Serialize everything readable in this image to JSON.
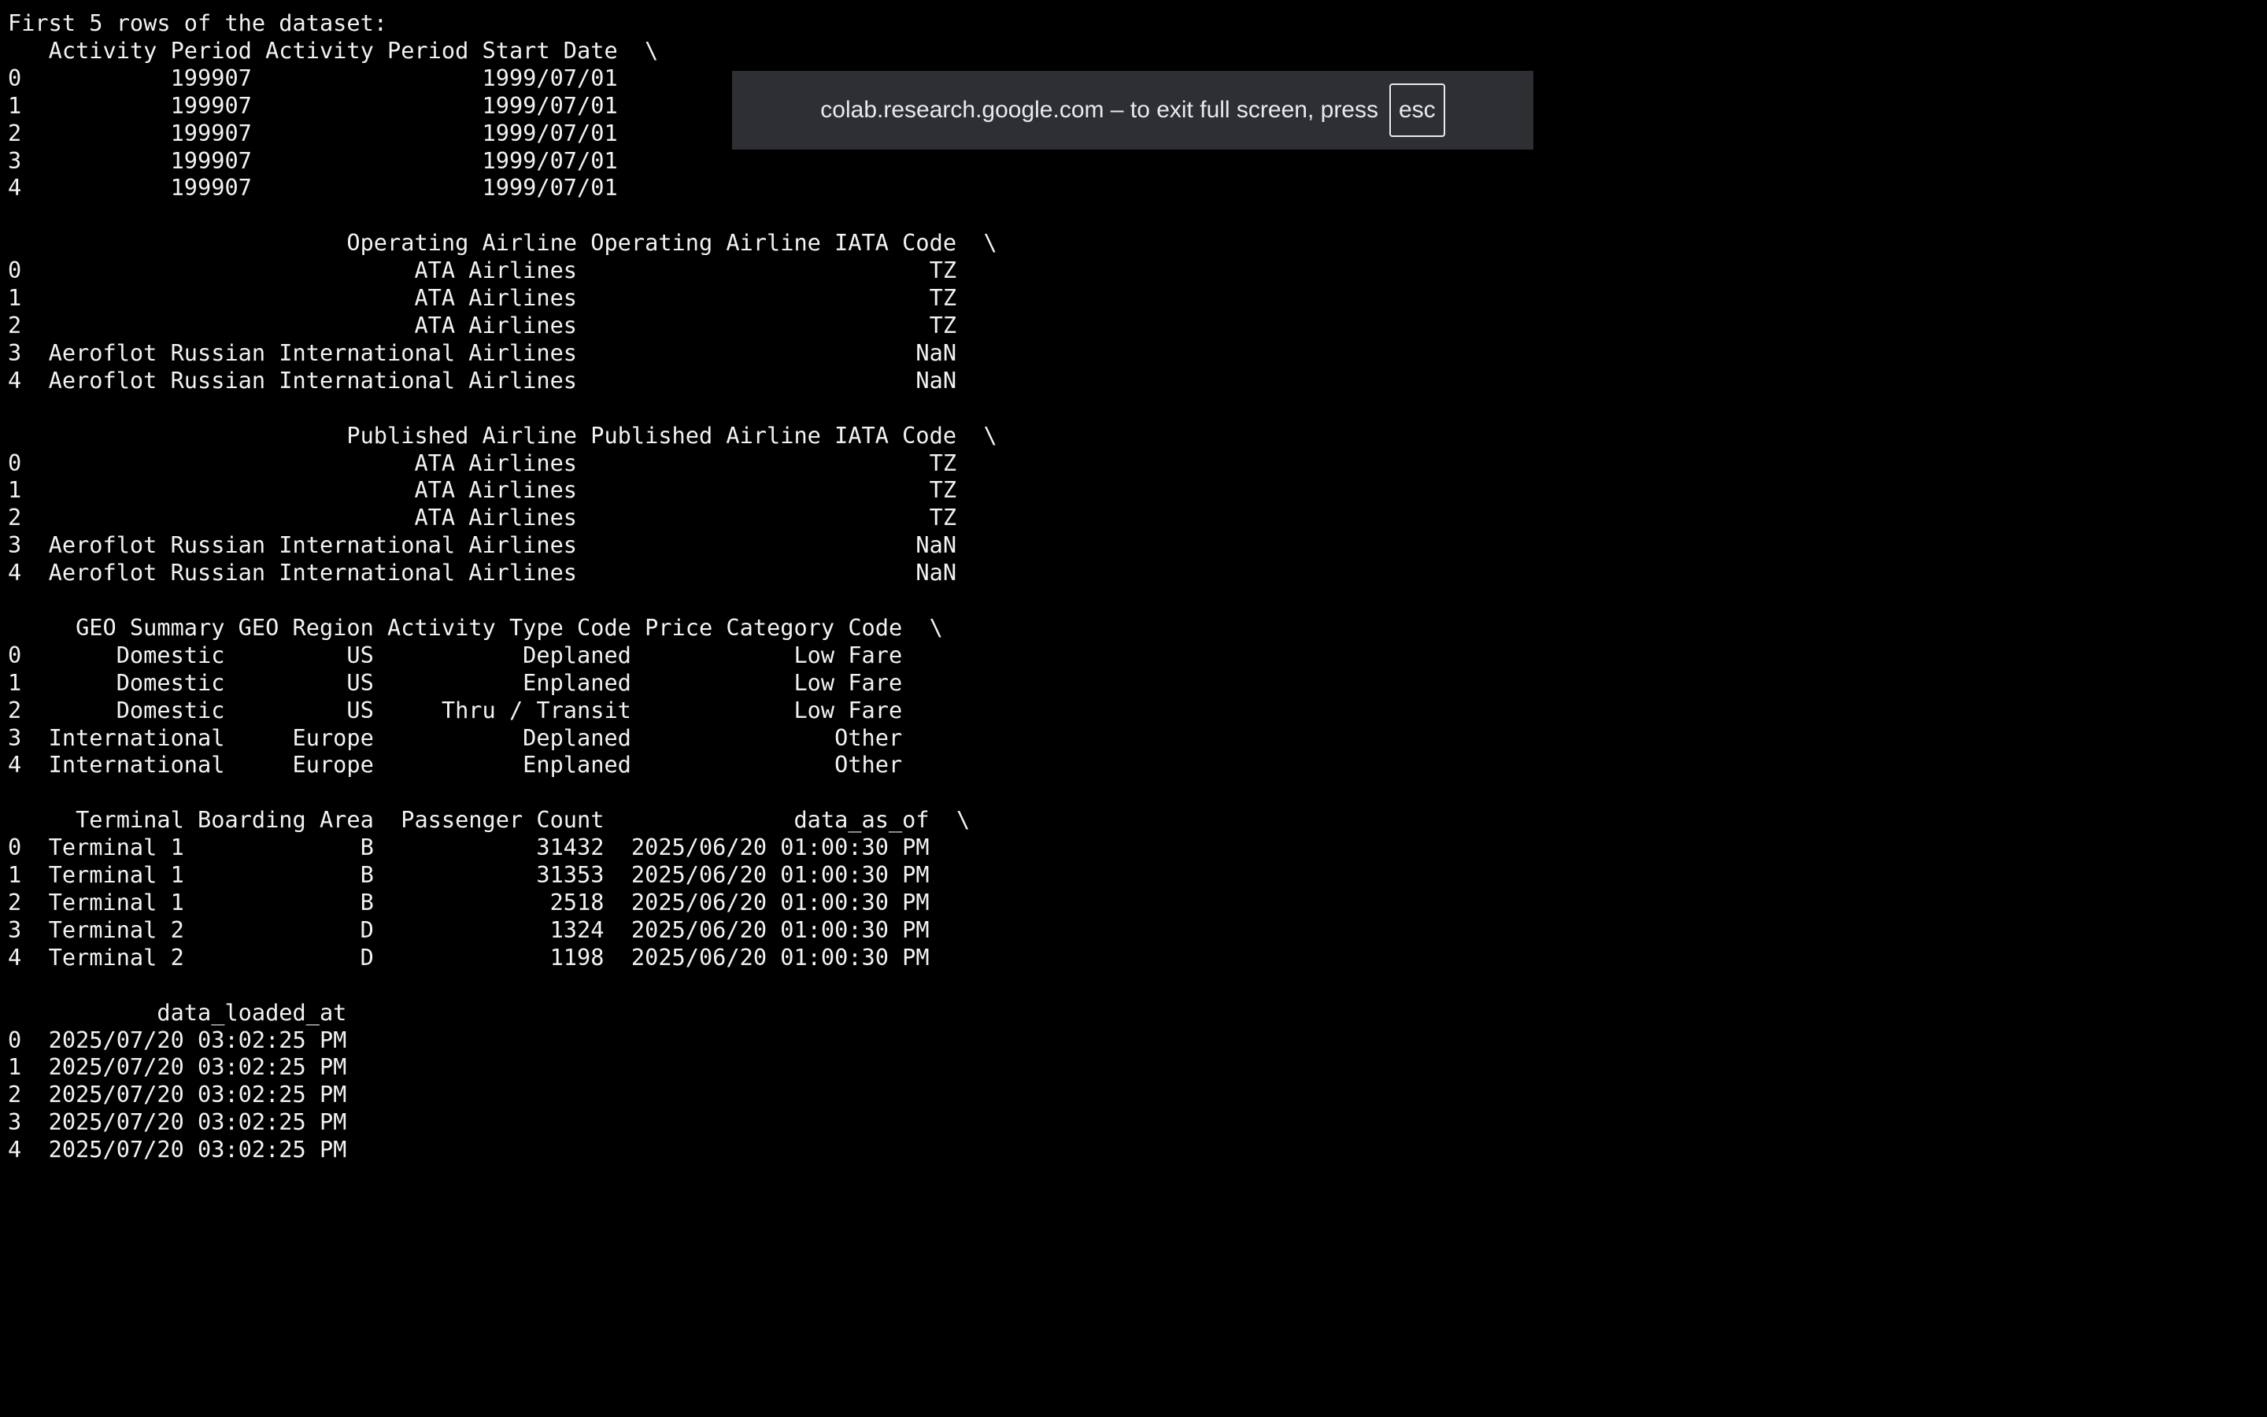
{
  "output": {
    "lines": [
      "First 5 rows of the dataset:",
      "   Activity Period Activity Period Start Date  \\",
      "0           199907                 1999/07/01   ",
      "1           199907                 1999/07/01   ",
      "2           199907                 1999/07/01   ",
      "3           199907                 1999/07/01   ",
      "4           199907                 1999/07/01   ",
      "",
      "                         Operating Airline Operating Airline IATA Code  \\",
      "0                             ATA Airlines                          TZ   ",
      "1                             ATA Airlines                          TZ   ",
      "2                             ATA Airlines                          TZ   ",
      "3  Aeroflot Russian International Airlines                         NaN   ",
      "4  Aeroflot Russian International Airlines                         NaN   ",
      "",
      "                         Published Airline Published Airline IATA Code  \\",
      "0                             ATA Airlines                          TZ   ",
      "1                             ATA Airlines                          TZ   ",
      "2                             ATA Airlines                          TZ   ",
      "3  Aeroflot Russian International Airlines                         NaN   ",
      "4  Aeroflot Russian International Airlines                         NaN   ",
      "",
      "     GEO Summary GEO Region Activity Type Code Price Category Code  \\",
      "0       Domestic         US           Deplaned            Low Fare   ",
      "1       Domestic         US           Enplaned            Low Fare   ",
      "2       Domestic         US     Thru / Transit            Low Fare   ",
      "3  International     Europe           Deplaned               Other   ",
      "4  International     Europe           Enplaned               Other   ",
      "",
      "     Terminal Boarding Area  Passenger Count              data_as_of  \\",
      "0  Terminal 1             B            31432  2025/06/20 01:00:30 PM   ",
      "1  Terminal 1             B            31353  2025/06/20 01:00:30 PM   ",
      "2  Terminal 1             B             2518  2025/06/20 01:00:30 PM   ",
      "3  Terminal 2             D             1324  2025/06/20 01:00:30 PM   ",
      "4  Terminal 2             D             1198  2025/06/20 01:00:30 PM   ",
      "",
      "           data_loaded_at  ",
      "0  2025/07/20 03:02:25 PM  ",
      "1  2025/07/20 03:02:25 PM  ",
      "2  2025/07/20 03:02:25 PM  ",
      "3  2025/07/20 03:02:25 PM  ",
      "4  2025/07/20 03:02:25 PM  "
    ]
  },
  "fullscreen_toast": {
    "message": "colab.research.google.com – to exit full screen, press",
    "key_label": "esc"
  },
  "colors": {
    "background": "#000000",
    "text": "#f2f2f2",
    "toast_background": "#2d2f33"
  }
}
